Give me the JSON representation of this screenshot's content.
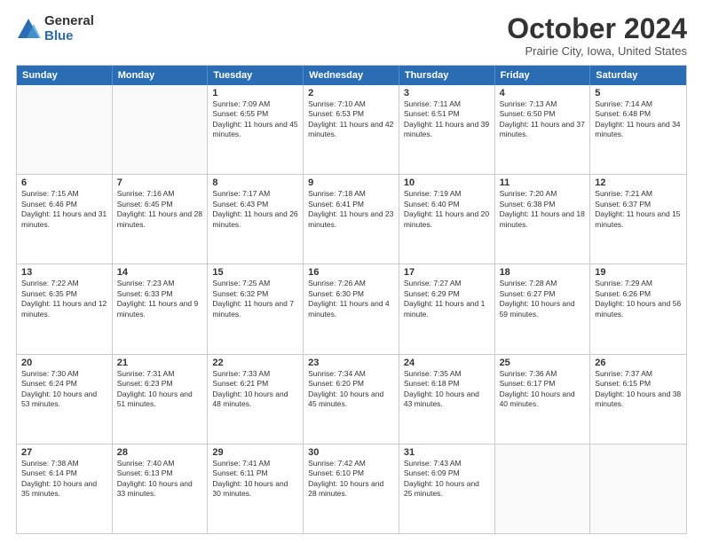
{
  "logo": {
    "general": "General",
    "blue": "Blue"
  },
  "title": "October 2024",
  "location": "Prairie City, Iowa, United States",
  "header_days": [
    "Sunday",
    "Monday",
    "Tuesday",
    "Wednesday",
    "Thursday",
    "Friday",
    "Saturday"
  ],
  "weeks": [
    [
      {
        "day": "",
        "sunrise": "",
        "sunset": "",
        "daylight": ""
      },
      {
        "day": "",
        "sunrise": "",
        "sunset": "",
        "daylight": ""
      },
      {
        "day": "1",
        "sunrise": "Sunrise: 7:09 AM",
        "sunset": "Sunset: 6:55 PM",
        "daylight": "Daylight: 11 hours and 45 minutes."
      },
      {
        "day": "2",
        "sunrise": "Sunrise: 7:10 AM",
        "sunset": "Sunset: 6:53 PM",
        "daylight": "Daylight: 11 hours and 42 minutes."
      },
      {
        "day": "3",
        "sunrise": "Sunrise: 7:11 AM",
        "sunset": "Sunset: 6:51 PM",
        "daylight": "Daylight: 11 hours and 39 minutes."
      },
      {
        "day": "4",
        "sunrise": "Sunrise: 7:13 AM",
        "sunset": "Sunset: 6:50 PM",
        "daylight": "Daylight: 11 hours and 37 minutes."
      },
      {
        "day": "5",
        "sunrise": "Sunrise: 7:14 AM",
        "sunset": "Sunset: 6:48 PM",
        "daylight": "Daylight: 11 hours and 34 minutes."
      }
    ],
    [
      {
        "day": "6",
        "sunrise": "Sunrise: 7:15 AM",
        "sunset": "Sunset: 6:46 PM",
        "daylight": "Daylight: 11 hours and 31 minutes."
      },
      {
        "day": "7",
        "sunrise": "Sunrise: 7:16 AM",
        "sunset": "Sunset: 6:45 PM",
        "daylight": "Daylight: 11 hours and 28 minutes."
      },
      {
        "day": "8",
        "sunrise": "Sunrise: 7:17 AM",
        "sunset": "Sunset: 6:43 PM",
        "daylight": "Daylight: 11 hours and 26 minutes."
      },
      {
        "day": "9",
        "sunrise": "Sunrise: 7:18 AM",
        "sunset": "Sunset: 6:41 PM",
        "daylight": "Daylight: 11 hours and 23 minutes."
      },
      {
        "day": "10",
        "sunrise": "Sunrise: 7:19 AM",
        "sunset": "Sunset: 6:40 PM",
        "daylight": "Daylight: 11 hours and 20 minutes."
      },
      {
        "day": "11",
        "sunrise": "Sunrise: 7:20 AM",
        "sunset": "Sunset: 6:38 PM",
        "daylight": "Daylight: 11 hours and 18 minutes."
      },
      {
        "day": "12",
        "sunrise": "Sunrise: 7:21 AM",
        "sunset": "Sunset: 6:37 PM",
        "daylight": "Daylight: 11 hours and 15 minutes."
      }
    ],
    [
      {
        "day": "13",
        "sunrise": "Sunrise: 7:22 AM",
        "sunset": "Sunset: 6:35 PM",
        "daylight": "Daylight: 11 hours and 12 minutes."
      },
      {
        "day": "14",
        "sunrise": "Sunrise: 7:23 AM",
        "sunset": "Sunset: 6:33 PM",
        "daylight": "Daylight: 11 hours and 9 minutes."
      },
      {
        "day": "15",
        "sunrise": "Sunrise: 7:25 AM",
        "sunset": "Sunset: 6:32 PM",
        "daylight": "Daylight: 11 hours and 7 minutes."
      },
      {
        "day": "16",
        "sunrise": "Sunrise: 7:26 AM",
        "sunset": "Sunset: 6:30 PM",
        "daylight": "Daylight: 11 hours and 4 minutes."
      },
      {
        "day": "17",
        "sunrise": "Sunrise: 7:27 AM",
        "sunset": "Sunset: 6:29 PM",
        "daylight": "Daylight: 11 hours and 1 minute."
      },
      {
        "day": "18",
        "sunrise": "Sunrise: 7:28 AM",
        "sunset": "Sunset: 6:27 PM",
        "daylight": "Daylight: 10 hours and 59 minutes."
      },
      {
        "day": "19",
        "sunrise": "Sunrise: 7:29 AM",
        "sunset": "Sunset: 6:26 PM",
        "daylight": "Daylight: 10 hours and 56 minutes."
      }
    ],
    [
      {
        "day": "20",
        "sunrise": "Sunrise: 7:30 AM",
        "sunset": "Sunset: 6:24 PM",
        "daylight": "Daylight: 10 hours and 53 minutes."
      },
      {
        "day": "21",
        "sunrise": "Sunrise: 7:31 AM",
        "sunset": "Sunset: 6:23 PM",
        "daylight": "Daylight: 10 hours and 51 minutes."
      },
      {
        "day": "22",
        "sunrise": "Sunrise: 7:33 AM",
        "sunset": "Sunset: 6:21 PM",
        "daylight": "Daylight: 10 hours and 48 minutes."
      },
      {
        "day": "23",
        "sunrise": "Sunrise: 7:34 AM",
        "sunset": "Sunset: 6:20 PM",
        "daylight": "Daylight: 10 hours and 45 minutes."
      },
      {
        "day": "24",
        "sunrise": "Sunrise: 7:35 AM",
        "sunset": "Sunset: 6:18 PM",
        "daylight": "Daylight: 10 hours and 43 minutes."
      },
      {
        "day": "25",
        "sunrise": "Sunrise: 7:36 AM",
        "sunset": "Sunset: 6:17 PM",
        "daylight": "Daylight: 10 hours and 40 minutes."
      },
      {
        "day": "26",
        "sunrise": "Sunrise: 7:37 AM",
        "sunset": "Sunset: 6:15 PM",
        "daylight": "Daylight: 10 hours and 38 minutes."
      }
    ],
    [
      {
        "day": "27",
        "sunrise": "Sunrise: 7:38 AM",
        "sunset": "Sunset: 6:14 PM",
        "daylight": "Daylight: 10 hours and 35 minutes."
      },
      {
        "day": "28",
        "sunrise": "Sunrise: 7:40 AM",
        "sunset": "Sunset: 6:13 PM",
        "daylight": "Daylight: 10 hours and 33 minutes."
      },
      {
        "day": "29",
        "sunrise": "Sunrise: 7:41 AM",
        "sunset": "Sunset: 6:11 PM",
        "daylight": "Daylight: 10 hours and 30 minutes."
      },
      {
        "day": "30",
        "sunrise": "Sunrise: 7:42 AM",
        "sunset": "Sunset: 6:10 PM",
        "daylight": "Daylight: 10 hours and 28 minutes."
      },
      {
        "day": "31",
        "sunrise": "Sunrise: 7:43 AM",
        "sunset": "Sunset: 6:09 PM",
        "daylight": "Daylight: 10 hours and 25 minutes."
      },
      {
        "day": "",
        "sunrise": "",
        "sunset": "",
        "daylight": ""
      },
      {
        "day": "",
        "sunrise": "",
        "sunset": "",
        "daylight": ""
      }
    ]
  ]
}
